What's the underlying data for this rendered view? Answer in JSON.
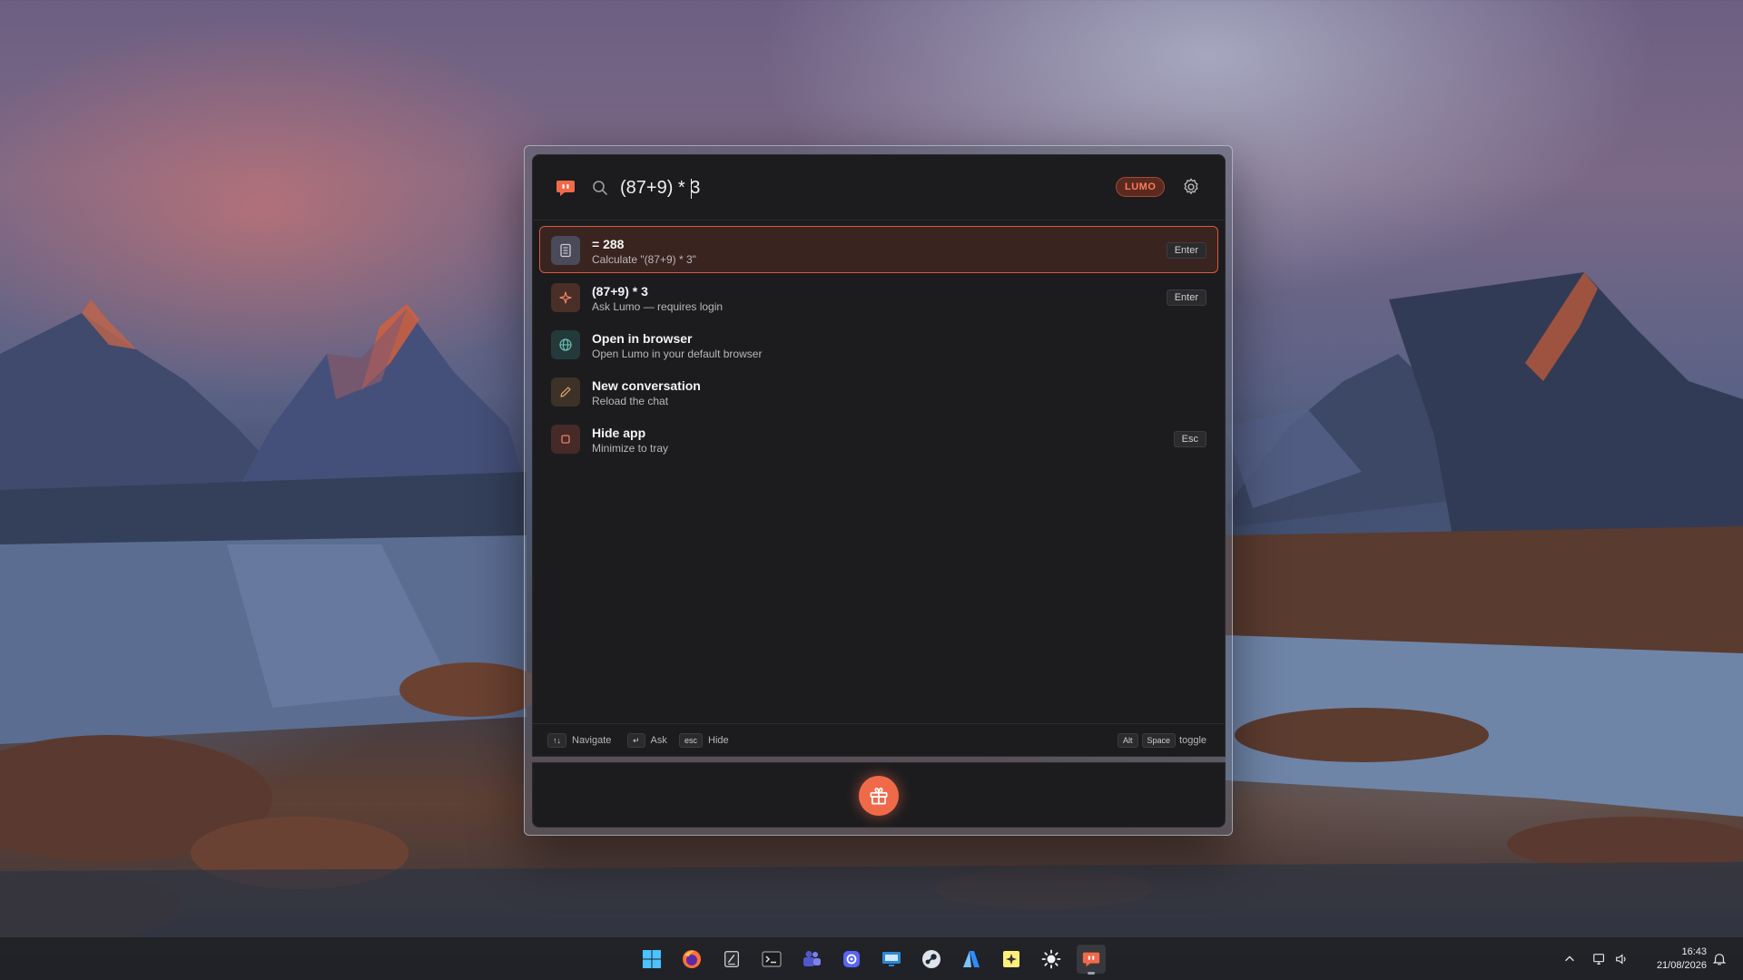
{
  "launcher": {
    "search": {
      "value": "(87+9) * 3",
      "badge": "LUMO"
    },
    "results": [
      {
        "icon": "calculator-icon",
        "title": "= 288",
        "subtitle": "Calculate \"(87+9) * 3\"",
        "shortcut": "Enter",
        "selected": true
      },
      {
        "icon": "sparkle-icon",
        "title": "(87+9) * 3",
        "subtitle": "Ask Lumo — requires login",
        "shortcut": "Enter",
        "selected": false
      },
      {
        "icon": "globe-icon",
        "title": "Open in browser",
        "subtitle": "Open Lumo in your default browser",
        "shortcut": "",
        "selected": false
      },
      {
        "icon": "pencil-icon",
        "title": "New conversation",
        "subtitle": "Reload the chat",
        "shortcut": "",
        "selected": false
      },
      {
        "icon": "square-icon",
        "title": "Hide app",
        "subtitle": "Minimize to tray",
        "shortcut": "Esc",
        "selected": false
      }
    ],
    "footer": {
      "navigate_key": "↑↓",
      "navigate_label": "Navigate",
      "ask_key": "↵",
      "ask_label": "Ask",
      "hide_key": "esc",
      "hide_label": "Hide",
      "toggle_key1": "Alt",
      "toggle_key2": "Space",
      "toggle_label": "toggle"
    }
  },
  "taskbar": {
    "apps": [
      "windows-start-icon",
      "firefox-icon",
      "notepad-icon",
      "terminal-icon",
      "teams-icon",
      "discord-icon",
      "remote-desktop-icon",
      "steam-icon",
      "azure-icon",
      "sticky-notes-icon",
      "settings-sun-icon",
      "lumo-icon"
    ],
    "time": "16:43",
    "date": "21/08/2026"
  },
  "colors": {
    "accent": "#f06a4a",
    "panel_bg": "#1c1c1e",
    "selected_bg": "#3a2420",
    "selected_border": "#d95a3e"
  }
}
